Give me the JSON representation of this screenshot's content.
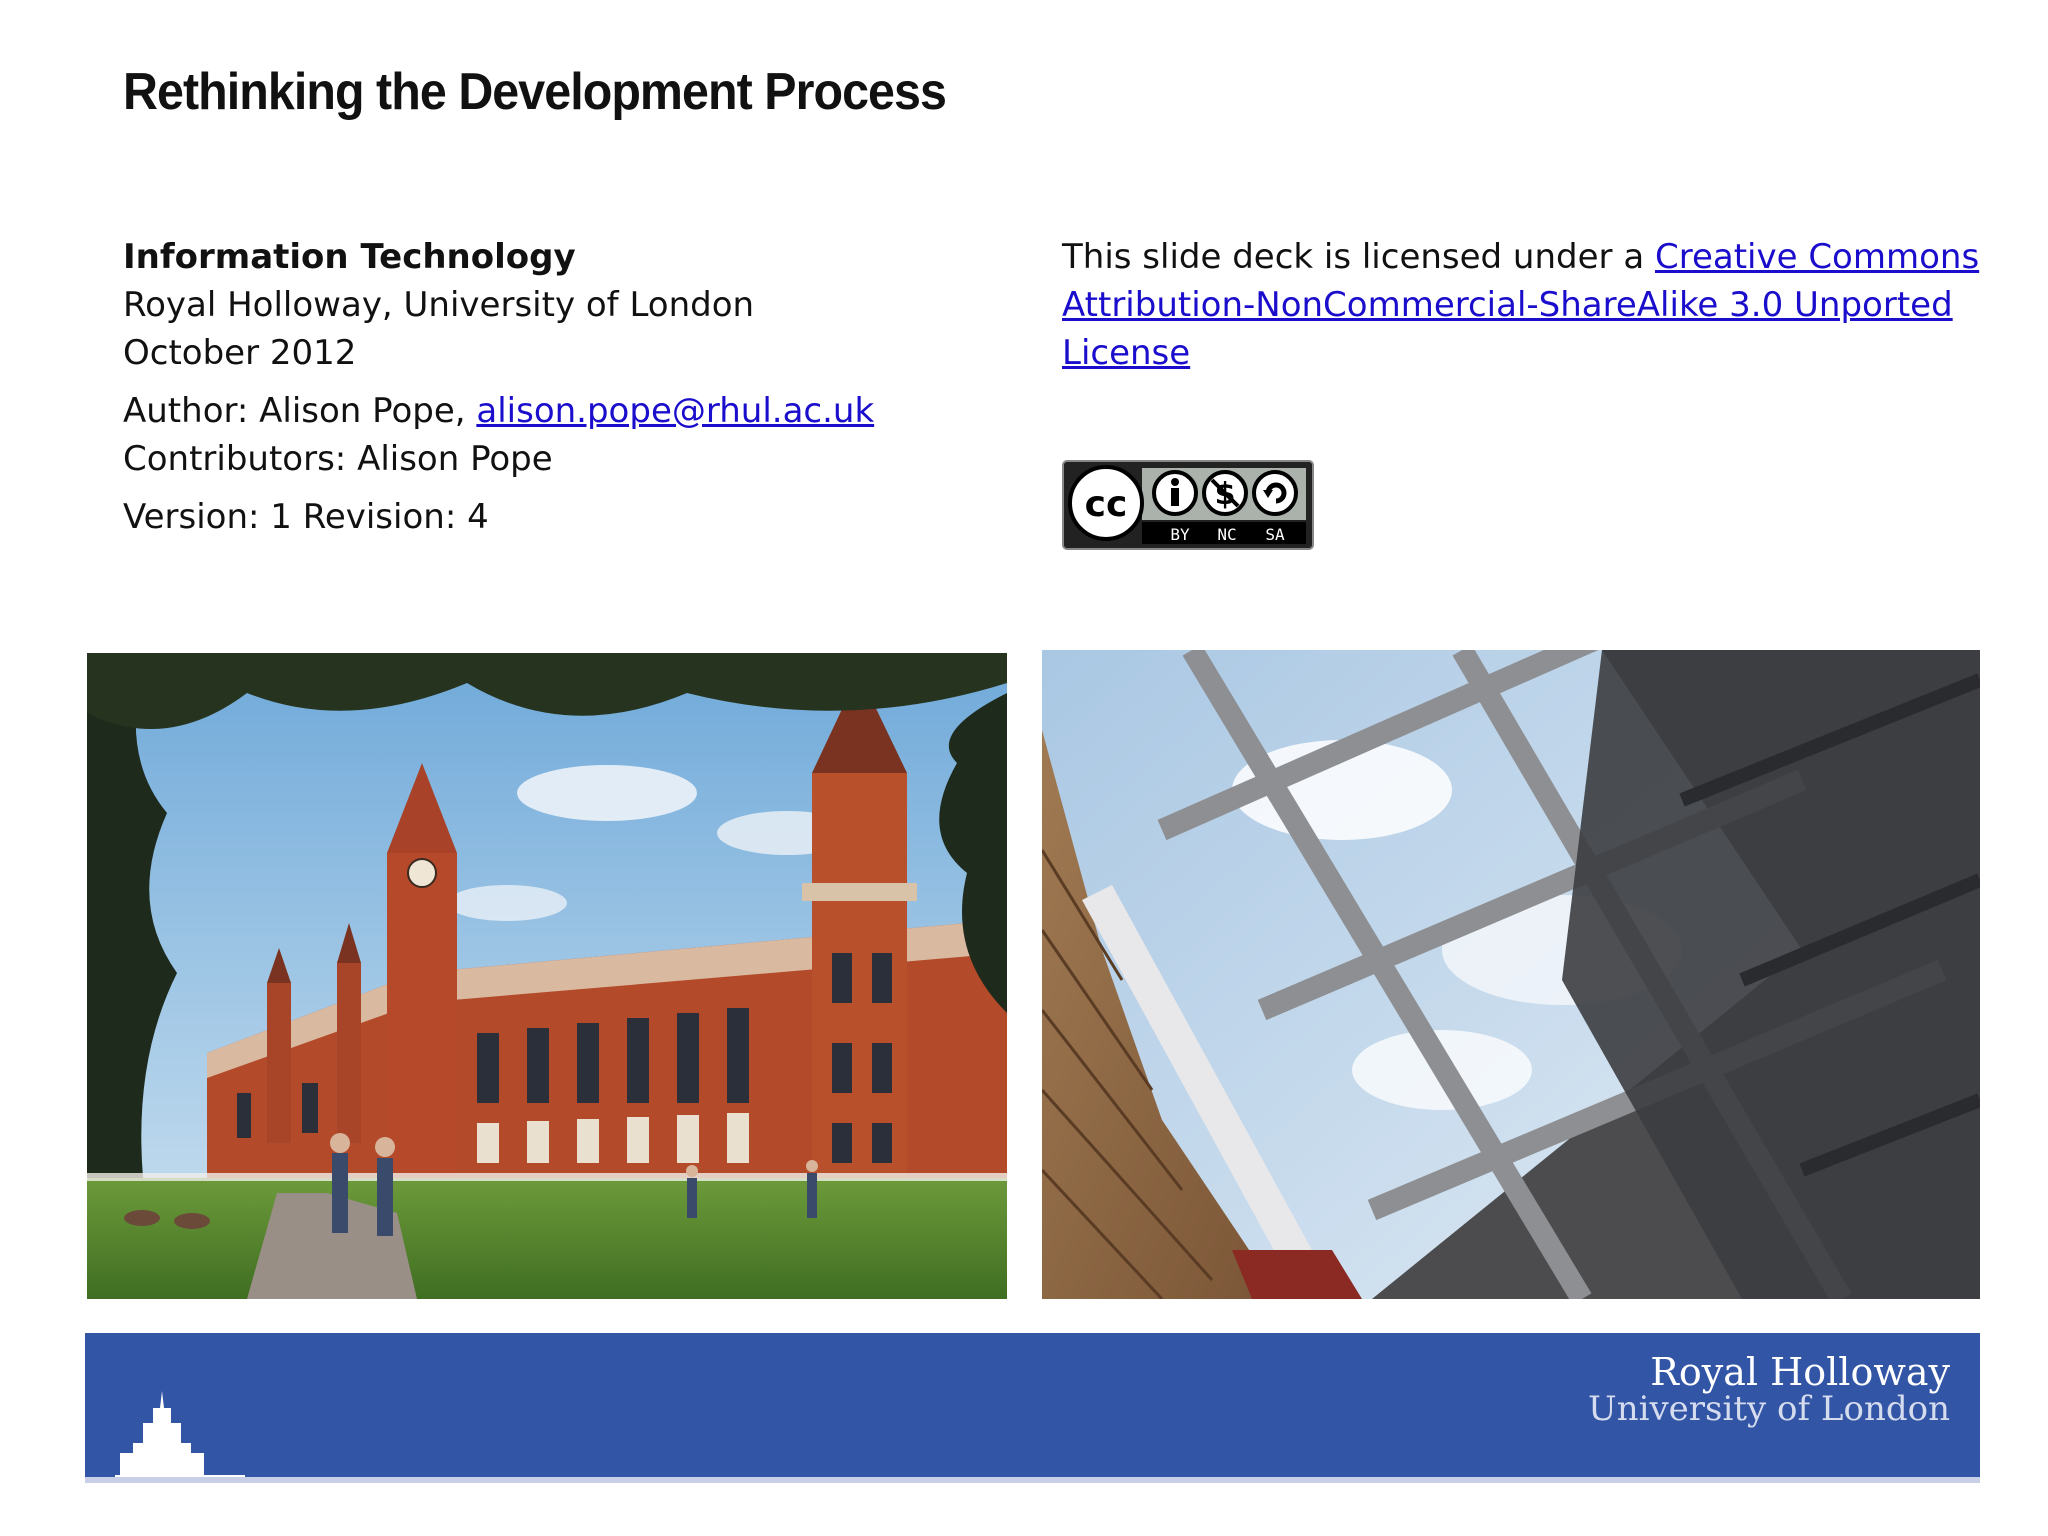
{
  "title": "Rethinking the Development Process",
  "info": {
    "department": "Information Technology",
    "institution": "Royal Holloway, University of London",
    "date": "October 2012",
    "author_prefix": "Author: Alison Pope, ",
    "author_email": "alison.pope@rhul.ac.uk",
    "contributors": "Contributors: Alison Pope",
    "version": "Version: 1 Revision: 4"
  },
  "license": {
    "text": "This slide deck is licensed under a ",
    "link_text": "Creative Commons Attribution-NonCommercial-ShareAlike 3.0 Unported License",
    "badge_labels": [
      "BY",
      "NC",
      "SA"
    ]
  },
  "banner": {
    "logo_line1": "Royal Holloway",
    "logo_line2": "University of London"
  },
  "colors": {
    "banner": "#3355a6",
    "link": "#1a0dcc"
  }
}
